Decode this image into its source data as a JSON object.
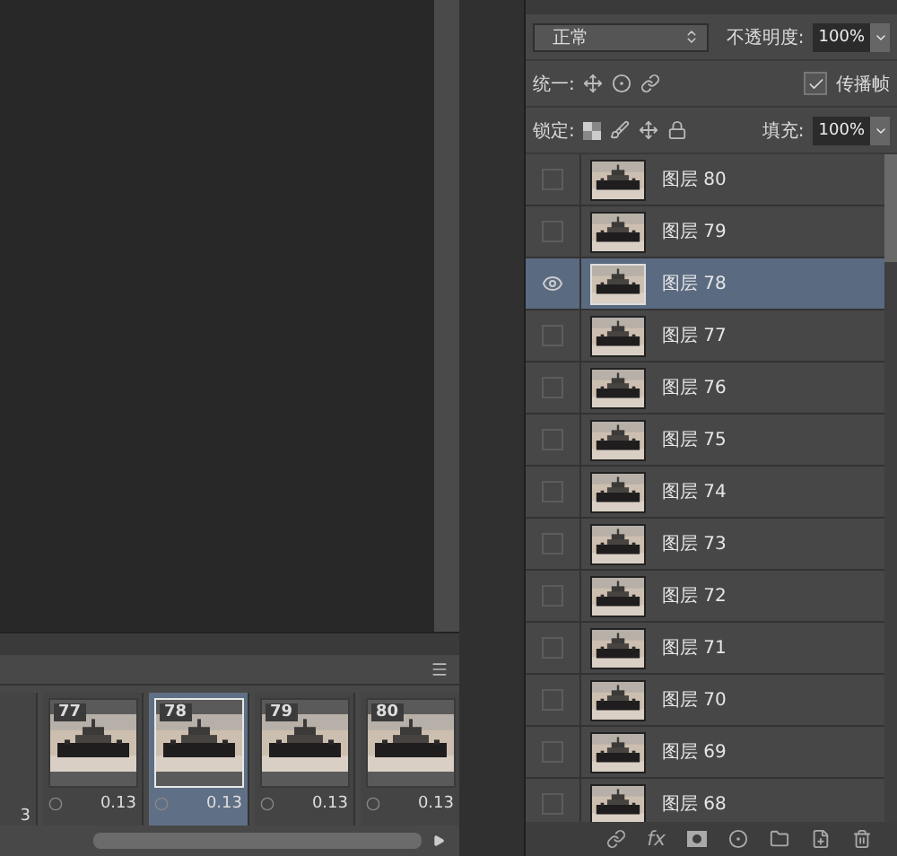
{
  "timeline": {
    "frames": [
      {
        "kind": "partial",
        "delay": "3",
        "selected": false
      },
      {
        "kind": "full",
        "number": "77",
        "delay": "0.13",
        "selected": false
      },
      {
        "kind": "full",
        "number": "78",
        "delay": "0.13",
        "selected": true
      },
      {
        "kind": "full",
        "number": "79",
        "delay": "0.13",
        "selected": false
      },
      {
        "kind": "full",
        "number": "80",
        "delay": "0.13",
        "selected": false
      }
    ]
  },
  "layers_panel": {
    "blend_mode": "正常",
    "opacity_label": "不透明度:",
    "opacity": "100%",
    "unify_label": "统一:",
    "propagate": {
      "label": "传播帧",
      "checked": true
    },
    "lock_label": "锁定:",
    "fill_label": "填充:",
    "fill": "100%",
    "layers": [
      {
        "name": "图层 80",
        "visible": false,
        "selected": false
      },
      {
        "name": "图层 79",
        "visible": false,
        "selected": false
      },
      {
        "name": "图层 78",
        "visible": true,
        "selected": true
      },
      {
        "name": "图层 77",
        "visible": false,
        "selected": false
      },
      {
        "name": "图层 76",
        "visible": false,
        "selected": false
      },
      {
        "name": "图层 75",
        "visible": false,
        "selected": false
      },
      {
        "name": "图层 74",
        "visible": false,
        "selected": false
      },
      {
        "name": "图层 73",
        "visible": false,
        "selected": false
      },
      {
        "name": "图层 72",
        "visible": false,
        "selected": false
      },
      {
        "name": "图层 71",
        "visible": false,
        "selected": false
      },
      {
        "name": "图层 70",
        "visible": false,
        "selected": false
      },
      {
        "name": "图层 69",
        "visible": false,
        "selected": false
      },
      {
        "name": "图层 68",
        "visible": false,
        "selected": false
      }
    ],
    "fx_label": "fx"
  }
}
